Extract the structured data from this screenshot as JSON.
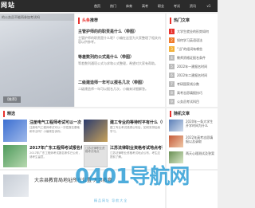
{
  "logo": "网站",
  "nav": [
    "首页",
    "热门",
    "体育",
    "高考",
    "职业",
    "考试",
    "资讯",
    "v1"
  ],
  "feature": {
    "caption": "的公务员不能再参加考试吗",
    "tag": "【推荐】"
  },
  "middle": {
    "heading_prefix": "头条",
    "heading": "推荐",
    "items": [
      {
        "title": "主管护师的的职责是什么（带图）",
        "desc": "主管护师的职责是什么呢？小编在这里为大家整理了相关内容以供参考。"
      },
      {
        "title": "等差数列的公式是什么（带图）",
        "desc": "等差数列通项公式与求和公式整理，希望对大家有帮助。"
      },
      {
        "title": "二级建造师一年可以报名几次（带图）",
        "desc": "二级建造师一年可以报名几次，小编来详细解答。"
      }
    ]
  },
  "hot": {
    "heading": "热门文章",
    "items": [
      "大学生就业的形势如何",
      "如何学习英语语法",
      "“当”的组词有哪些",
      "教师资格证报名条件",
      "2022年一建报名时间",
      "2022年二建报名时间",
      "考研国家线分数",
      "高考志愿填报技巧",
      "公务员考试科目"
    ]
  },
  "articles": {
    "heading_prefix": "精选",
    "items": [
      {
        "title": "注册电气工程师考试可以一次",
        "desc": "注册电气工程师考试可以一次性报名基础和专业吗？小编来告诉你。"
      },
      {
        "title": "建工专业的等待时平有什么（带图）",
        "desc": "建工专业考试成绩公布后，如何安排后续学习。"
      },
      {
        "title": "2017年广东工程师考试报名条件",
        "desc": "2017年广东工程师考试报名条件已公布，请考生留意。"
      },
      {
        "title": "江苏法律职业资格考试地点考试",
        "desc": "江苏法律职业资格考试地点公布，考生应提前了解。"
      }
    ],
    "img_alt": "江苏法律职业资格考试地点"
  },
  "random": {
    "heading": "随机文章",
    "items": [
      "2020年一条大学生开学时间为什么",
      "2022年高考志愿填报以及录取",
      "两天心理测试及答案"
    ]
  },
  "bottom": {
    "title": "大余县教育局地址所在位置 大余教育"
  },
  "watermark": {
    "text": "0401导航网",
    "sub": "精品网址 导航大全"
  }
}
